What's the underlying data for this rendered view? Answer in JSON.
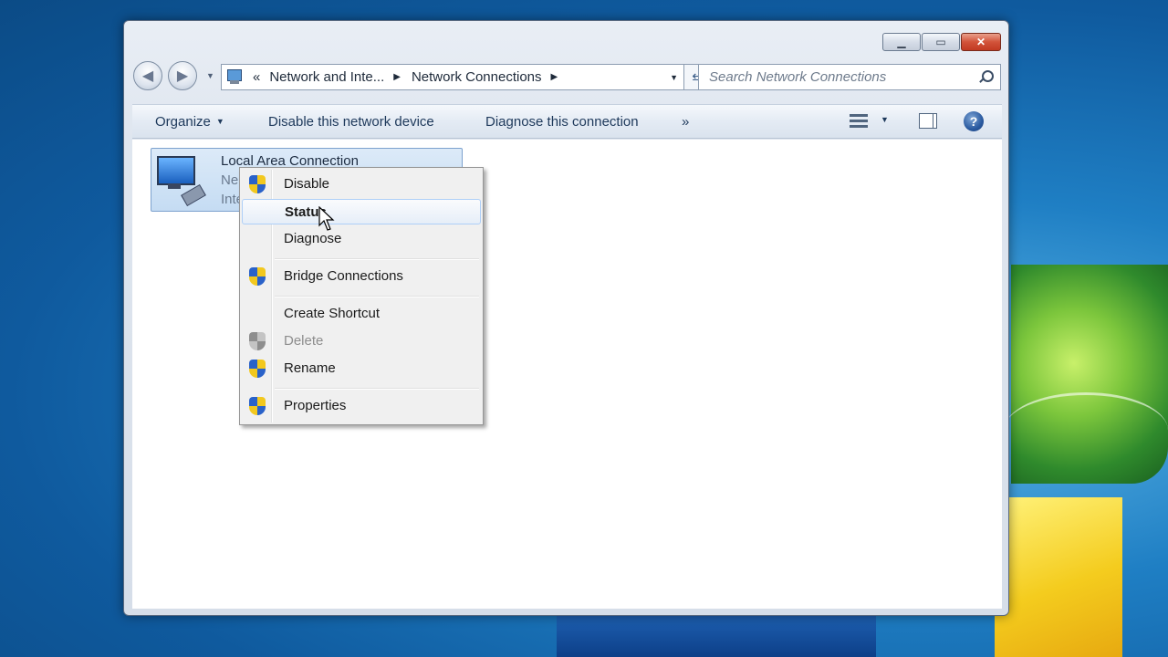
{
  "address_bar": {
    "overflow_glyph": "«",
    "crumbs": [
      "Network and Inte...",
      "Network Connections"
    ]
  },
  "search": {
    "placeholder": "Search Network Connections"
  },
  "toolbar": {
    "organize": "Organize",
    "disable_device": "Disable this network device",
    "diagnose_connection": "Diagnose this connection",
    "more": "»"
  },
  "connection": {
    "name": "Local Area Connection",
    "line2": "Ne",
    "line3": "Inte"
  },
  "context_menu": {
    "items": [
      {
        "label": "Disable",
        "shield": true,
        "state": "normal"
      },
      {
        "label": "Status",
        "shield": false,
        "state": "hover-default"
      },
      {
        "label": "Diagnose",
        "shield": false,
        "state": "normal"
      },
      {
        "label": "Bridge Connections",
        "shield": true,
        "state": "normal"
      },
      {
        "label": "Create Shortcut",
        "shield": false,
        "state": "normal"
      },
      {
        "label": "Delete",
        "shield": true,
        "state": "disabled"
      },
      {
        "label": "Rename",
        "shield": true,
        "state": "normal"
      },
      {
        "label": "Properties",
        "shield": true,
        "state": "normal"
      }
    ]
  },
  "icons": {
    "back": "back-arrow-icon",
    "forward": "forward-arrow-icon",
    "refresh": "refresh-icon",
    "search": "search-icon",
    "views": "views-icon",
    "preview_pane": "preview-pane-icon",
    "help": "help-icon",
    "uac": "uac-shield-icon"
  },
  "colors": {
    "menu_hover_border": "#aecff7",
    "selection_bg": "#c5dcf3",
    "toolbar_text": "#1e395b"
  }
}
